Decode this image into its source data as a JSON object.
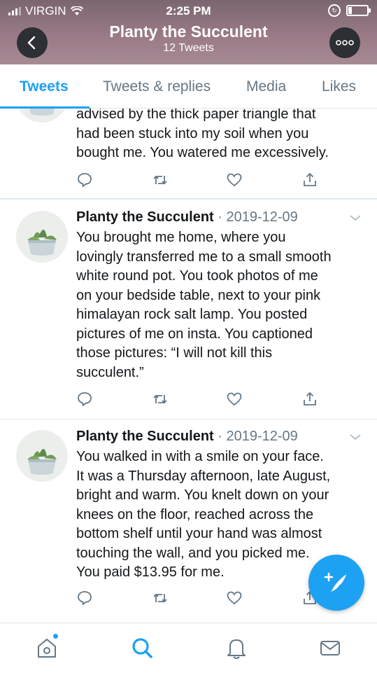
{
  "status_bar": {
    "carrier": "VIRGIN",
    "time": "2:25 PM"
  },
  "header": {
    "title": "Planty the Succulent",
    "subtitle": "12 Tweets"
  },
  "tabs": [
    {
      "label": "Tweets",
      "active": true
    },
    {
      "label": "Tweets & replies",
      "active": false
    },
    {
      "label": "Media",
      "active": false
    },
    {
      "label": "Likes",
      "active": false
    }
  ],
  "tweets": [
    {
      "lines": [
        "advised by the thick paper triangle that",
        "had been stuck into my soil when you",
        "bought me. You watered me excessively."
      ]
    },
    {
      "name": "Planty the Succulent",
      "date": "· 2019-12-09",
      "lines": [
        "You brought me home, where you",
        "lovingly transferred me to a small smooth",
        "white round pot. You took photos of me",
        "on your bedside table, next to your pink",
        "himalayan rock salt lamp. You posted",
        "pictures of me on insta. You captioned",
        "those pictures: “I will not kill this",
        "succulent.”"
      ]
    },
    {
      "name": "Planty the Succulent",
      "date": "· 2019-12-09",
      "lines": [
        "You walked in with a smile on your face.",
        "It was a Thursday afternoon, late August,",
        "bright and warm. You knelt down on your",
        "knees on the floor, reached across the",
        "bottom shelf until your hand was almost",
        "touching the wall, and you picked me.",
        "You paid $13.95 for me."
      ]
    }
  ],
  "icons": {
    "back": "chevron-left-icon",
    "more": "more-icon",
    "reply": "reply-icon",
    "retweet": "retweet-icon",
    "like": "heart-icon",
    "share": "share-icon",
    "compose": "compose-icon",
    "home": "home-icon",
    "search": "search-icon",
    "notifications": "bell-icon",
    "messages": "mail-icon"
  },
  "colors": {
    "accent": "#1da1f2",
    "text": "#14171a",
    "muted": "#657786",
    "border": "#e1e8ed"
  }
}
